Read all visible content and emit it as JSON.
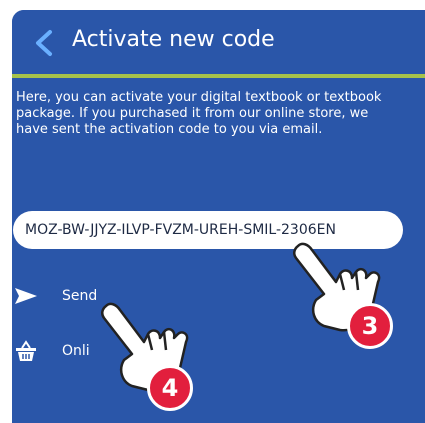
{
  "header": {
    "title": "Activate new code",
    "back_icon": "chevron-left-icon"
  },
  "description": "Here, you can activate your digital textbook or textbook package. If you purchased it from our online store, we have sent the activation code to you via email.",
  "code_field": {
    "value": "MOZ-BW-JJYZ-ILVP-FVZM-UREH-SMIL-2306EN"
  },
  "actions": {
    "send": {
      "label": "Send",
      "icon": "send-icon"
    },
    "online": {
      "label": "Onli",
      "icon": "basket-icon"
    }
  },
  "annotations": {
    "step3": "3",
    "step4": "4"
  },
  "colors": {
    "panel": "#2a56a9",
    "accent": "#a6c24a",
    "badge": "#e21f3d"
  }
}
